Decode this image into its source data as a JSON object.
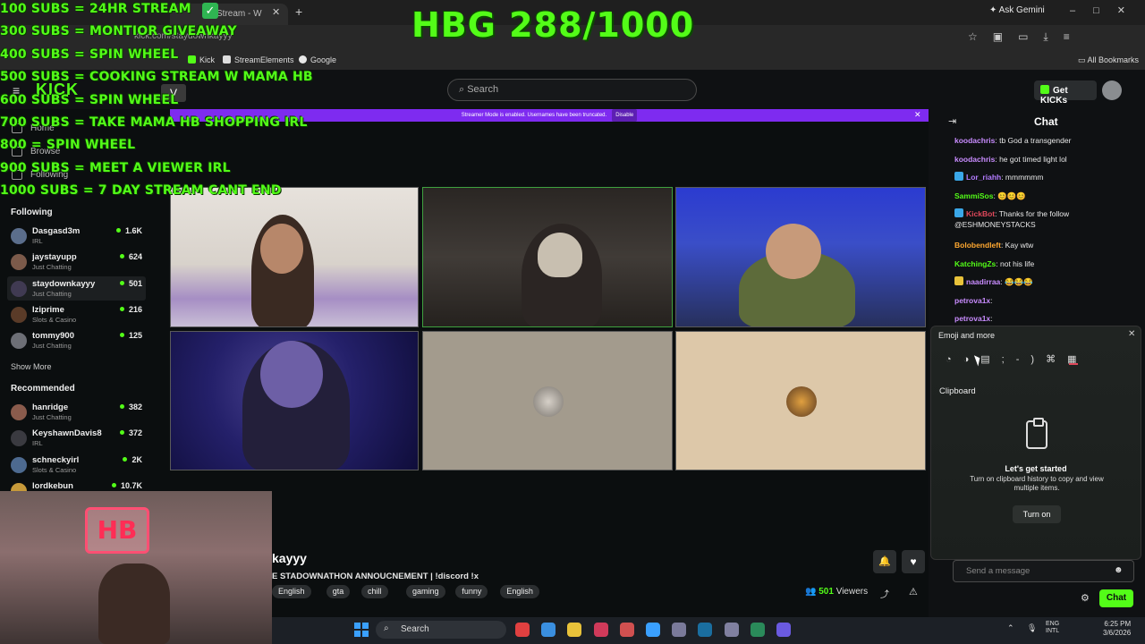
{
  "overlay": {
    "goals": [
      "100 SUBS = 24HR STREAM",
      "300 SUBS = MONTIOR GIVEAWAY",
      "400 SUBS = SPIN WHEEL",
      "500 SUBS = COOKING STREAM W MAMA HB",
      "600 SUBS = SPIN WHEEL",
      "700 SUBS = TAKE MAMA HB SHOPPING IRL",
      "800 = SPIN WHEEL",
      "900 SUBS =  MEET A VIEWER IRL",
      "1000 SUBS = 7 DAY STREAM CANT END"
    ],
    "counter": "HBG 288/1000",
    "webcam_sign": "HB"
  },
  "browser": {
    "tab_title": "Stream - W",
    "tab_close": "✕",
    "new_tab": "+",
    "check_icon": "✓",
    "ask_gemini": "Ask Gemini",
    "window_controls": "–□✕",
    "url": "kick.com/staydownkayyy",
    "toolbar_icons": "☆▣▭⤓≡",
    "bookmarks": [
      "Kick",
      "StreamElements",
      "Google"
    ],
    "all_bookmarks": "All Bookmarks"
  },
  "header": {
    "logo": "KICK",
    "menu_icon": "≡",
    "v_badge": "V",
    "search_placeholder": "Search",
    "get_kicks": "Get KICKs"
  },
  "banner": {
    "text": "Streamer Mode is enabled. Usernames have been truncated.",
    "disable": "Disable",
    "close": "✕"
  },
  "sidebar": {
    "nav": [
      "Home",
      "Browse",
      "Following"
    ],
    "following_title": "Following",
    "following": [
      {
        "name": "Dasgasd3m",
        "category": "IRL",
        "viewers": "1.6K",
        "avatar": "#5b6e8c"
      },
      {
        "name": "jaystayupp",
        "category": "Just Chatting",
        "viewers": "624",
        "avatar": "#7b5a4a"
      },
      {
        "name": "staydownkayyy",
        "category": "Just Chatting",
        "viewers": "501",
        "avatar": "#403a52"
      },
      {
        "name": "Iziprime",
        "category": "Slots & Casino",
        "viewers": "216",
        "avatar": "#5a3b28"
      },
      {
        "name": "tommy900",
        "category": "Just Chatting",
        "viewers": "125",
        "avatar": "#6d6f76"
      }
    ],
    "show_more": "Show More",
    "recommended_title": "Recommended",
    "recommended": [
      {
        "name": "hanridge",
        "category": "Just Chatting",
        "viewers": "382",
        "avatar": "#8a5b4c"
      },
      {
        "name": "KeyshawnDavis8",
        "category": "IRL",
        "viewers": "372",
        "avatar": "#3a3a40"
      },
      {
        "name": "schneckyirl",
        "category": "Slots & Casino",
        "viewers": "2K",
        "avatar": "#4d6a90"
      },
      {
        "name": "lordkebun",
        "category": "",
        "viewers": "10.7K",
        "avatar": "#c79a3a"
      }
    ]
  },
  "stream": {
    "streamer_partial": "kayyy",
    "title_partial": "E STADOWNATHON ANNOUCNEMENT | !discord !x",
    "tags": [
      "English",
      "gta",
      "chill",
      "gaming",
      "funny",
      "English"
    ],
    "viewers_count": "501",
    "viewers_label": "Viewers",
    "bell_icon": "🔔",
    "heart_icon": "♥",
    "share_icon": "⤴",
    "report_icon": "⚠"
  },
  "chat": {
    "title": "Chat",
    "collapse_icon": "⇥",
    "messages": [
      {
        "user": "koodachris",
        "text": ": tb God a transgender",
        "color": "#c98cff",
        "badge": ""
      },
      {
        "user": "koodachris",
        "text": ": he got timed light lol",
        "color": "#c98cff",
        "badge": ""
      },
      {
        "user": "Lor_riahh",
        "text": ": mmmmmm",
        "color": "#b37cff",
        "badge": "#3aa7e8"
      },
      {
        "user": "SammiSos",
        "text": ": 😊😊😊",
        "color": "#53fc18",
        "badge": ""
      },
      {
        "user": "KickBot",
        "text": ": Thanks for the follow @ESHMONEYSTACKS",
        "color": "#e0485b",
        "badge": "#3aa7e8"
      },
      {
        "user": "Bolobendleft",
        "text": ": Kay wtw",
        "color": "#ffa830",
        "badge": ""
      },
      {
        "user": "KatchingZs",
        "text": ": not his life",
        "color": "#53fc18",
        "badge": ""
      },
      {
        "user": "naadirraa",
        "text": ": 😂😂😂",
        "color": "#c98cff",
        "badge": "#e8c23a"
      },
      {
        "user": "petrova1x",
        "text": ":",
        "color": "#c98cff",
        "badge": ""
      },
      {
        "user": "petrova1x",
        "text": ":",
        "color": "#c98cff",
        "badge": ""
      }
    ],
    "input_placeholder": "Send a message",
    "emoji_icon": "☻",
    "send_label": "Chat",
    "gear_icon": "⚙"
  },
  "emoji_panel": {
    "title": "Emoji and more",
    "close": "✕",
    "tabs_icons": "◔◑▤;-)⌘▦",
    "clipboard_heading": "Clipboard",
    "start_title": "Let's get started",
    "start_desc": "Turn on clipboard history to copy and view multiple items.",
    "turn_on": "Turn on"
  },
  "taskbar": {
    "search": "Search",
    "search_icon": "⌕",
    "tray": "⌃ 🎙",
    "lang_line1": "ENG",
    "lang_line2": "INTL",
    "time": "6:25 PM",
    "date": "3/6/2026",
    "apps": [
      "#e04040",
      "#3a8fe0",
      "#e8c23a",
      "#d03a5a",
      "#d05050",
      "#3aa0ff",
      "#7a7a9a",
      "#1a6ea0",
      "#8080a0",
      "#2a8a5a",
      "#6a5ae0"
    ]
  },
  "colors": {
    "accent": "#53fc18",
    "banner": "#7e2bf0"
  }
}
